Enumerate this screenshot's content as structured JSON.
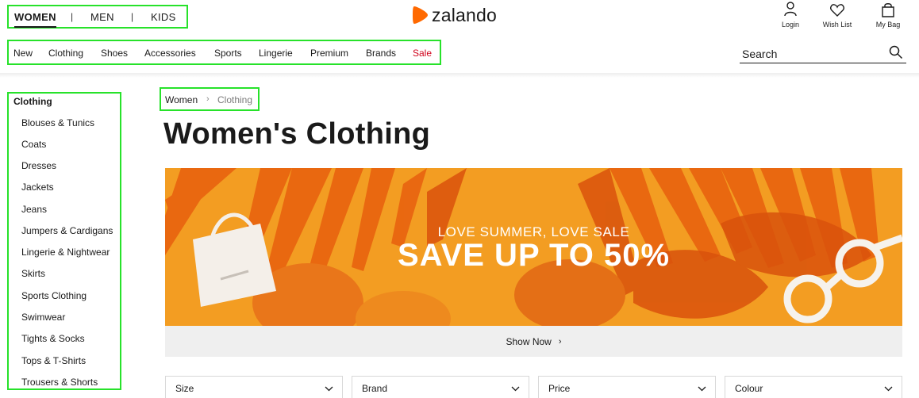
{
  "gender_nav": {
    "women": "WOMEN",
    "men": "MEN",
    "kids": "KIDS",
    "separator": "|"
  },
  "brand": {
    "name": "zalando",
    "accent_color": "#ff6900"
  },
  "account": {
    "login": "Login",
    "wishlist": "Wish List",
    "bag": "My Bag"
  },
  "category_nav": [
    "New",
    "Clothing",
    "Shoes",
    "Accessories",
    "Sports",
    "Lingerie",
    "Premium",
    "Brands",
    "Sale"
  ],
  "search": {
    "placeholder": "Search"
  },
  "sidebar": {
    "heading": "Clothing",
    "items": [
      "Blouses & Tunics",
      "Coats",
      "Dresses",
      "Jackets",
      "Jeans",
      "Jumpers & Cardigans",
      "Lingerie & Nightwear",
      "Skirts",
      "Sports Clothing",
      "Swimwear",
      "Tights & Socks",
      "Tops & T-Shirts",
      "Trousers & Shorts"
    ]
  },
  "breadcrumb": {
    "level1": "Women",
    "level2": "Clothing",
    "separator": "›"
  },
  "page_title": "Women's Clothing",
  "banner": {
    "subtitle": "LOVE SUMMER, LOVE SALE",
    "headline": "SAVE UP TO 50%",
    "cta": "Show Now",
    "cta_arrow": "›"
  },
  "filters": [
    "Size",
    "Brand",
    "Price",
    "Colour"
  ],
  "highlight_color": "#27e22a"
}
